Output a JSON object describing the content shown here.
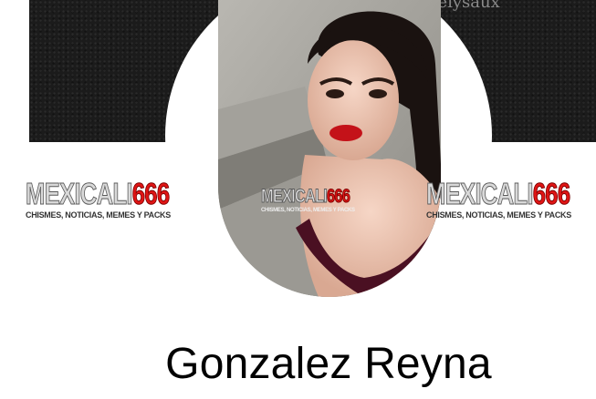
{
  "cover": {
    "username_overlay": "oneiysaux"
  },
  "watermark": {
    "brand_part1": "MEXICALI",
    "brand_part2": "666",
    "tagline": "CHISMES, NOTICIAS, MEMES Y PACKS"
  },
  "profile": {
    "name": "Gonzalez Reyna"
  },
  "colors": {
    "cover": "#1b1b1b",
    "brand_red": "#e01515",
    "name_text": "#000000"
  }
}
